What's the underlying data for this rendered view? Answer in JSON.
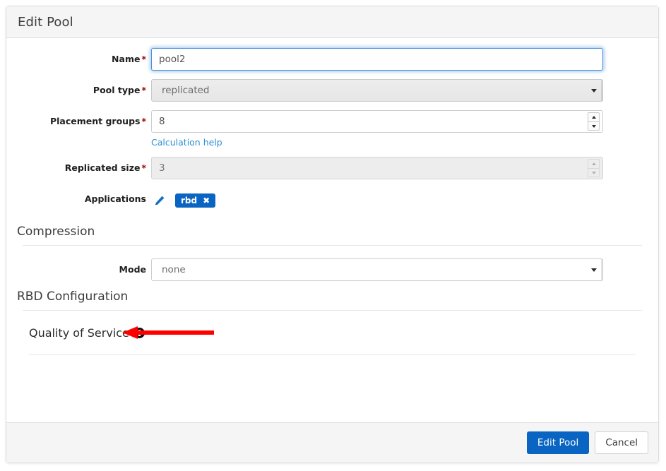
{
  "dialog": {
    "title": "Edit Pool"
  },
  "form": {
    "name": {
      "label": "Name",
      "required": "*",
      "value": "pool2"
    },
    "pool_type": {
      "label": "Pool type",
      "required": "*",
      "value": "replicated"
    },
    "placement_groups": {
      "label": "Placement groups",
      "required": "*",
      "value": "8",
      "help_link": "Calculation help"
    },
    "replicated_size": {
      "label": "Replicated size",
      "required": "*",
      "value": "3"
    },
    "applications": {
      "label": "Applications",
      "edit_icon": "pencil-icon",
      "badges": [
        {
          "label": "rbd",
          "remove_icon": "close-icon"
        }
      ]
    }
  },
  "compression": {
    "heading": "Compression",
    "mode": {
      "label": "Mode",
      "value": "none"
    }
  },
  "rbd_configuration": {
    "heading": "RBD Configuration",
    "quality_of_service": {
      "label": "Quality of Service",
      "expand_icon": "plus-circle-icon"
    }
  },
  "annotation": {
    "arrow_color": "#ff0000",
    "direction": "left"
  },
  "footer": {
    "submit_label": "Edit Pool",
    "cancel_label": "Cancel"
  },
  "colors": {
    "primary": "#0a64c2",
    "link": "#2b8fd4",
    "required": "#a30000",
    "focus_border": "#4a90d9",
    "header_bg": "#f5f5f5"
  }
}
